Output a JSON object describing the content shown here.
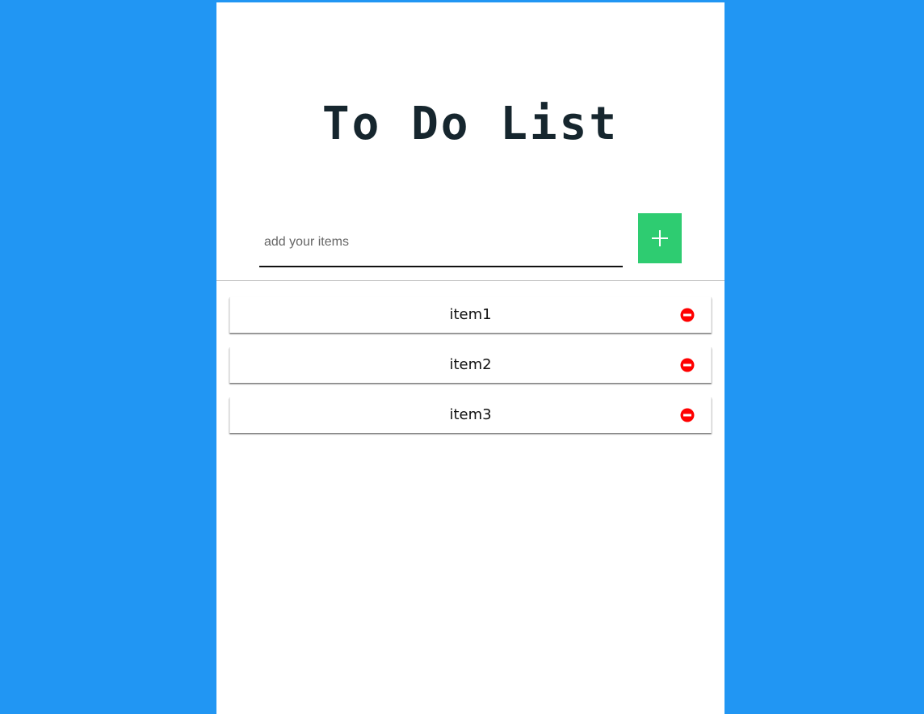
{
  "app": {
    "title": "To Do List"
  },
  "form": {
    "placeholder": "add your items",
    "value": "",
    "add_icon": "plus-icon"
  },
  "colors": {
    "background": "#2196F3",
    "add_button": "#2ecc71",
    "remove_icon": "#ff0000"
  },
  "items": [
    {
      "label": "item1",
      "remove_icon": "minus-circle-icon"
    },
    {
      "label": "item2",
      "remove_icon": "minus-circle-icon"
    },
    {
      "label": "item3",
      "remove_icon": "minus-circle-icon"
    }
  ]
}
